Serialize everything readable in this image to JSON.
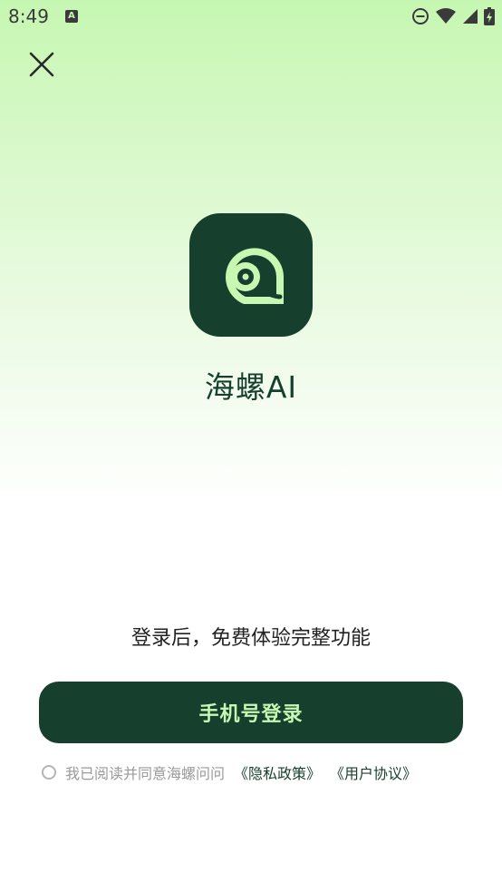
{
  "status_bar": {
    "time": "8:49",
    "notification_icon": "a-letter-icon",
    "icons": [
      "do-not-disturb-icon",
      "wifi-icon",
      "cellular-signal-icon",
      "battery-charging-icon"
    ]
  },
  "close_icon": "close-icon",
  "app": {
    "logo_icon": "snail-shell-spiral-icon",
    "name": "海螺AI"
  },
  "login_hint": "登录后，免费体验完整功能",
  "login_button_label": "手机号登录",
  "agreement": {
    "checked": false,
    "text": "我已阅读并同意海螺问问",
    "privacy_link": "《隐私政策》",
    "terms_link": "《用户协议》"
  },
  "colors": {
    "brand_dark": "#173f2e",
    "brand_light": "#c8f7b2",
    "gradient_top": "#c6f7b2"
  }
}
